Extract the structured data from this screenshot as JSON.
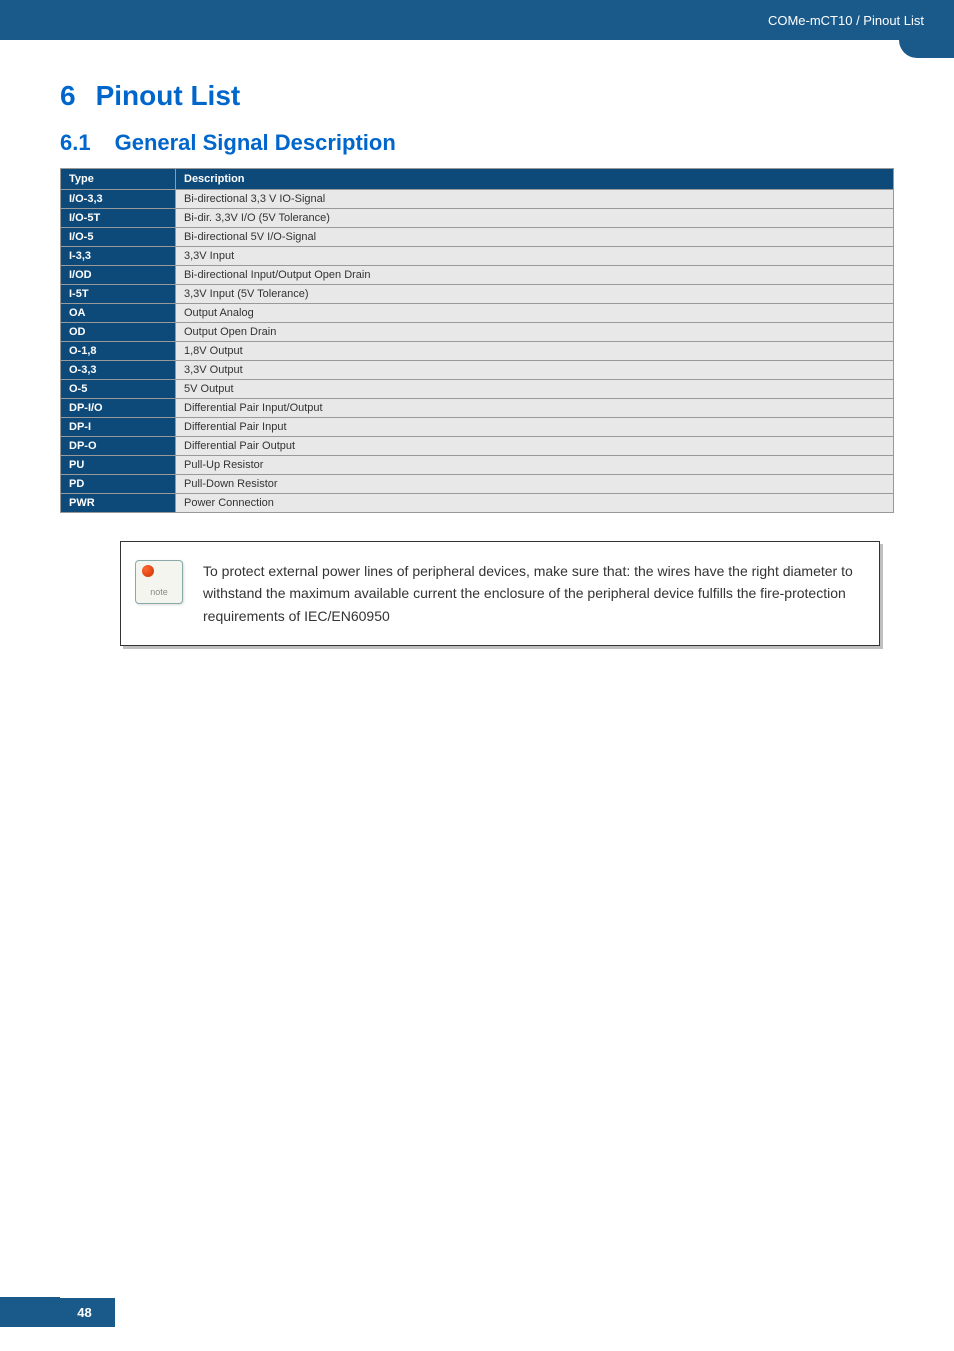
{
  "header": {
    "breadcrumb": "COMe-mCT10 / Pinout List"
  },
  "section": {
    "number": "6",
    "title": "Pinout List"
  },
  "subsection": {
    "number": "6.1",
    "title": "General Signal Description"
  },
  "table": {
    "headers": {
      "type": "Type",
      "description": "Description"
    },
    "rows": [
      {
        "type": "I/O-3,3",
        "desc": "Bi-directional 3,3 V IO-Signal"
      },
      {
        "type": "I/O-5T",
        "desc": "Bi-dir. 3,3V I/O (5V Tolerance)"
      },
      {
        "type": "I/O-5",
        "desc": "Bi-directional 5V I/O-Signal"
      },
      {
        "type": "I-3,3",
        "desc": "3,3V Input"
      },
      {
        "type": "I/OD",
        "desc": "Bi-directional Input/Output Open Drain"
      },
      {
        "type": "I-5T",
        "desc": "3,3V Input (5V Tolerance)"
      },
      {
        "type": "OA",
        "desc": "Output Analog"
      },
      {
        "type": "OD",
        "desc": "Output Open Drain"
      },
      {
        "type": "O-1,8",
        "desc": "1,8V Output"
      },
      {
        "type": "O-3,3",
        "desc": "3,3V Output"
      },
      {
        "type": "O-5",
        "desc": "5V Output"
      },
      {
        "type": "DP-I/O",
        "desc": "Differential Pair Input/Output"
      },
      {
        "type": "DP-I",
        "desc": "Differential Pair Input"
      },
      {
        "type": "DP-O",
        "desc": "Differential Pair Output"
      },
      {
        "type": "PU",
        "desc": "Pull-Up Resistor"
      },
      {
        "type": "PD",
        "desc": "Pull-Down Resistor"
      },
      {
        "type": "PWR",
        "desc": "Power Connection"
      }
    ]
  },
  "note": {
    "icon_label": "note",
    "text": "To protect external power lines of peripheral devices, make sure that: the wires have the right diameter to withstand the maximum available current the enclosure of the peripheral device fulfills the fire-protection requirements of IEC/EN60950"
  },
  "footer": {
    "page": "48"
  }
}
